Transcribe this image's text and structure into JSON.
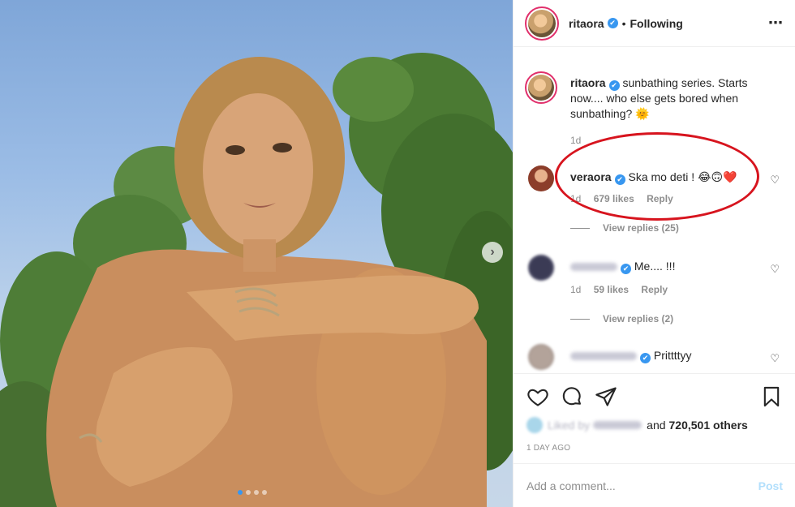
{
  "header": {
    "username": "ritaora",
    "verified_mark": "✔",
    "separator": "•",
    "follow_status": "Following",
    "more_icon": "⋯"
  },
  "caption": {
    "username": "ritaora",
    "text": "sunbathing series. Starts now.... who else gets bored when sunbathing?",
    "emoji": "🌞",
    "time": "1d"
  },
  "comments": [
    {
      "username": "veraora",
      "text": "Ska mo deti !",
      "emojis": [
        "😂",
        "🙃",
        "❤️"
      ],
      "time": "1d",
      "likes": "679 likes",
      "reply": "Reply",
      "view_replies": "View replies (25)"
    },
    {
      "text": "Me.... !!!",
      "time": "1d",
      "likes": "59 likes",
      "reply": "Reply",
      "view_replies": "View replies (2)"
    },
    {
      "text": "Prittttyy"
    }
  ],
  "likes": {
    "prefix": "Liked by",
    "suffix": "and",
    "count": "720,501 others"
  },
  "post_age": "1 day ago",
  "add_comment": {
    "placeholder": "Add a comment...",
    "post_label": "Post"
  },
  "carousel": {
    "next_icon": "›"
  },
  "colors": {
    "verified_blue": "#3897f0",
    "annotation_red": "#d7141e",
    "post_button_disabled": "#b2dffc"
  }
}
